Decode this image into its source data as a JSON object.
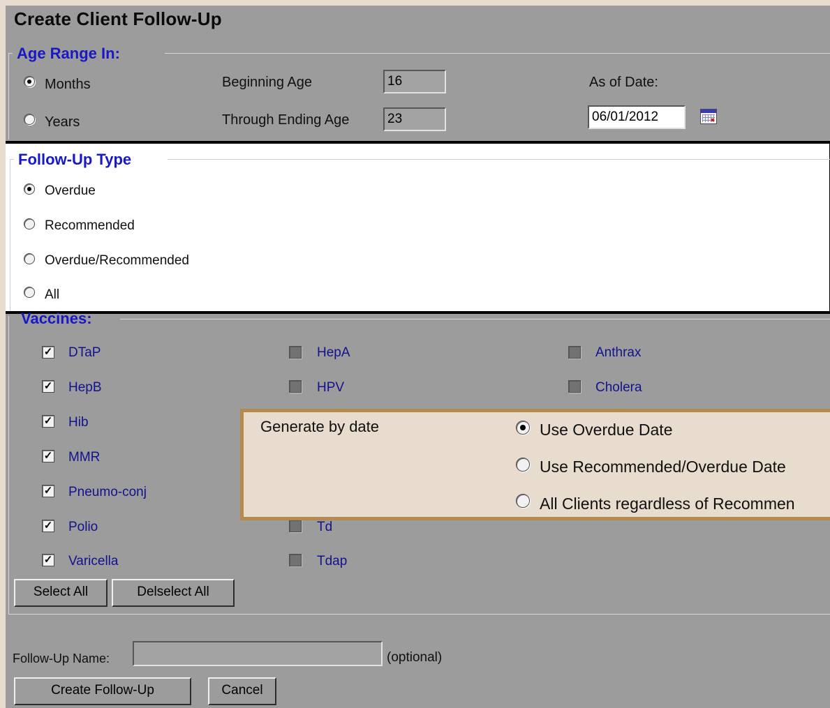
{
  "page": {
    "title": "Create Client Follow-Up"
  },
  "age_range": {
    "legend": "Age Range In:",
    "unit_options": [
      {
        "label": "Months",
        "selected": true
      },
      {
        "label": "Years",
        "selected": false
      }
    ],
    "beginning_age_label": "Beginning Age",
    "beginning_age_value": "16",
    "ending_age_label": "Through Ending Age",
    "ending_age_value": "23",
    "as_of_date_label": "As of Date:",
    "as_of_date_value": "06/01/2012",
    "calendar_icon": "calendar-icon"
  },
  "follow_up_type": {
    "legend": "Follow-Up Type",
    "options": [
      {
        "label": "Overdue",
        "selected": true
      },
      {
        "label": "Recommended",
        "selected": false
      },
      {
        "label": "Overdue/Recommended",
        "selected": false
      },
      {
        "label": "All",
        "selected": false
      }
    ]
  },
  "vaccines": {
    "legend": "Vaccines:",
    "col1": [
      {
        "label": "DTaP",
        "checked": true
      },
      {
        "label": "HepB",
        "checked": true
      },
      {
        "label": "Hib",
        "checked": true
      },
      {
        "label": "MMR",
        "checked": true
      },
      {
        "label": "Pneumo-conj",
        "checked": true
      },
      {
        "label": "Polio",
        "checked": true
      },
      {
        "label": "Varicella",
        "checked": true
      }
    ],
    "col2": [
      {
        "label": "HepA",
        "checked": false
      },
      {
        "label": "HPV",
        "checked": false
      },
      {
        "label": "Td",
        "checked": false
      },
      {
        "label": "Tdap",
        "checked": false
      }
    ],
    "col3": [
      {
        "label": "Anthrax",
        "checked": false
      },
      {
        "label": "Cholera",
        "checked": false
      }
    ],
    "select_all_label": "Select All",
    "deselect_all_label": "Delselect All"
  },
  "generate_by_date": {
    "label": "Generate by date",
    "options": [
      {
        "label": "Use Overdue Date",
        "selected": true
      },
      {
        "label": "Use Recommended/Overdue Date",
        "selected": false
      },
      {
        "label": "All Clients regardless of Recommen",
        "selected": false
      }
    ]
  },
  "footer": {
    "name_label": "Follow-Up Name:",
    "name_value": "",
    "optional_label": "(optional)",
    "create_label": "Create Follow-Up",
    "cancel_label": "Cancel"
  }
}
